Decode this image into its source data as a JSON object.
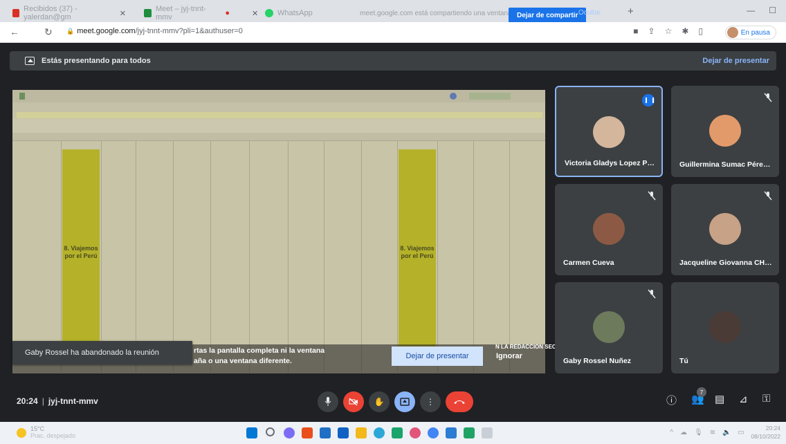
{
  "browser": {
    "tabs": [
      {
        "title": "Recibidos (37) - yalerdan@gm",
        "color": "#d93025"
      },
      {
        "title": "Meet – jyj-tnnt-mmv",
        "color": "#1e8e3e"
      },
      {
        "title": "",
        "color": "#d93025"
      },
      {
        "title": "WhatsApp",
        "color": "#25d366"
      }
    ],
    "share_banner": "meet.google.com está compartiendo una ventana.",
    "stop_share_label": "Dejar de compartir",
    "hide_label": "Ocultar",
    "url_host": "meet.google.com",
    "url_path": "/jyj-tnnt-mmv?pli=1&authuser=0",
    "pause_label": "En pausa"
  },
  "meet": {
    "presenting_text": "Estás presentando para todos",
    "stop_presenting_label": "Dejar de presentar",
    "leave_toast": "Gaby Rossel ha abandonado la reunión",
    "warning_line1": "rtas la pantalla completa ni la ventana",
    "warning_line2": "aña o una ventana diferente.",
    "dialog_stop_label": "Dejar de presentar",
    "dialog_ignore_label": "Ignorar",
    "sheet_overlay_text": "N LA REDACCION SEC",
    "meeting_time": "20:24",
    "meeting_code": "jyj-tnnt-mmv",
    "participants_badge": "7"
  },
  "sheet": {
    "yellow_label_1": "8. Viajemos por el Perú",
    "yellow_label_2": "8. Viajemos por el Perú"
  },
  "participants": [
    {
      "name": "Victoria Gladys Lopez Prti...",
      "speaking": true,
      "muted": false,
      "avatar_color": "#d3b69c"
    },
    {
      "name": "Guillermina Sumac Pérez ...",
      "speaking": false,
      "muted": true,
      "avatar_color": "#e39a6a"
    },
    {
      "name": "Carmen Cueva",
      "speaking": false,
      "muted": true,
      "avatar_color": "#8c5a44"
    },
    {
      "name": "Jacqueline Giovanna CHA...",
      "speaking": false,
      "muted": true,
      "avatar_color": "#c7a286"
    },
    {
      "name": "Gaby Rossel Nuñez",
      "speaking": false,
      "muted": true,
      "avatar_color": "#6d7a5c"
    },
    {
      "name": "Tú",
      "speaking": false,
      "muted": false,
      "avatar_color": "#4a3b36"
    }
  ],
  "taskbar": {
    "temp": "15°C",
    "weather": "Prac. despejado",
    "time": "20:24",
    "date": "08/10/2022"
  }
}
